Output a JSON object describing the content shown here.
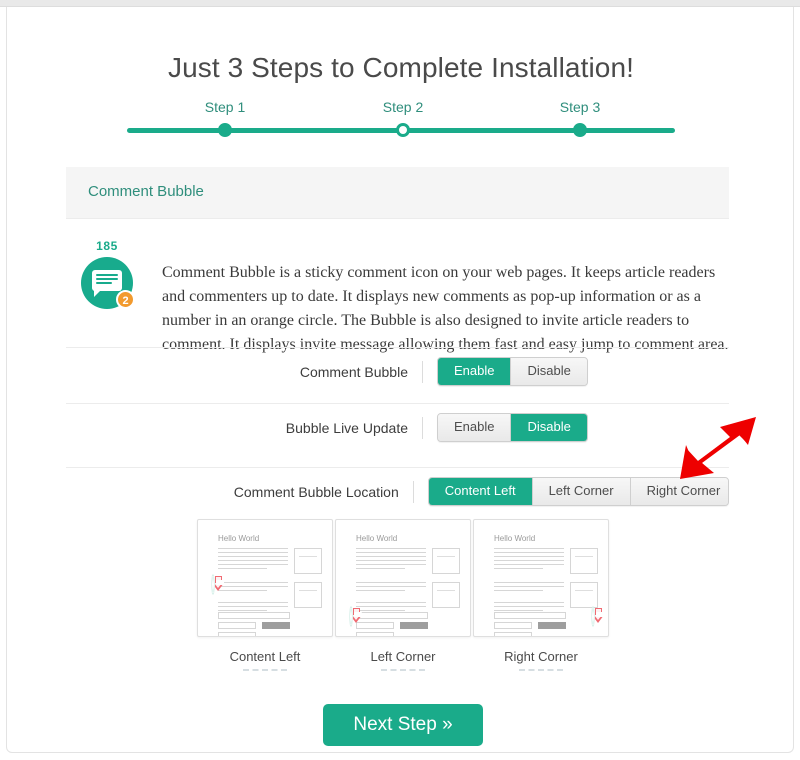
{
  "page": {
    "title": "Just 3 Steps to Complete Installation!"
  },
  "steps": {
    "items": [
      {
        "label": "Step 1",
        "state": "done"
      },
      {
        "label": "Step 2",
        "state": "current"
      },
      {
        "label": "Step 3",
        "state": "done"
      }
    ]
  },
  "section": {
    "header_title": "Comment Bubble",
    "intro": {
      "count": "185",
      "badge": "2",
      "text": "Comment Bubble is a sticky comment icon on your web pages. It keeps article readers and commenters up to date. It displays new comments as pop-up information or as a number in an orange circle. The Bubble is also designed to invite article readers to comment. It displays invite message allowing them fast and easy jump to comment area."
    }
  },
  "settings": {
    "comment_bubble": {
      "label": "Comment Bubble",
      "options": [
        "Enable",
        "Disable"
      ],
      "selected": "Enable"
    },
    "bubble_live_update": {
      "label": "Bubble Live Update",
      "options": [
        "Enable",
        "Disable"
      ],
      "selected": "Disable"
    },
    "comment_bubble_location": {
      "label": "Comment Bubble Location",
      "options": [
        "Content Left",
        "Left Corner",
        "Right Corner"
      ],
      "selected": "Content Left"
    }
  },
  "thumbnails": [
    {
      "label": "Content Left",
      "mock_title": "Hello World",
      "marker_position": "content-left"
    },
    {
      "label": "Left Corner",
      "mock_title": "Hello World",
      "marker_position": "left-corner"
    },
    {
      "label": "Right Corner",
      "mock_title": "Hello World",
      "marker_position": "right-corner"
    }
  ],
  "footer": {
    "next_step_label": "Next Step »"
  },
  "colors": {
    "accent_green": "#1aab8a",
    "header_green": "#2f8e7c",
    "badge_orange": "#f29a2e",
    "annotation_red": "#ee0000",
    "panel_gray": "#f5f5f5"
  }
}
